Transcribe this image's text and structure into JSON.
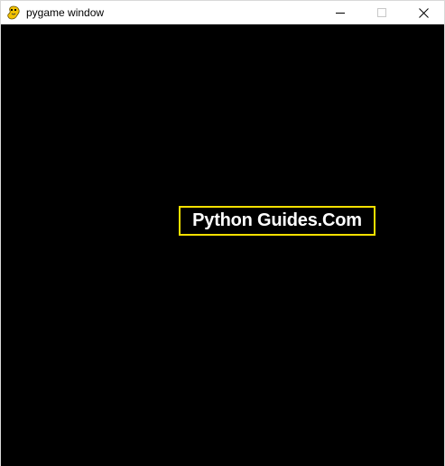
{
  "window": {
    "title": "pygame window",
    "icon": "pygame-snake-icon"
  },
  "controls": {
    "minimize_icon": "minimize-icon",
    "maximize_icon": "maximize-icon",
    "close_icon": "close-icon"
  },
  "canvas": {
    "background_color": "#000000",
    "text": "Python Guides.Com",
    "text_color": "#ffffff",
    "border_color": "#f5e000"
  }
}
